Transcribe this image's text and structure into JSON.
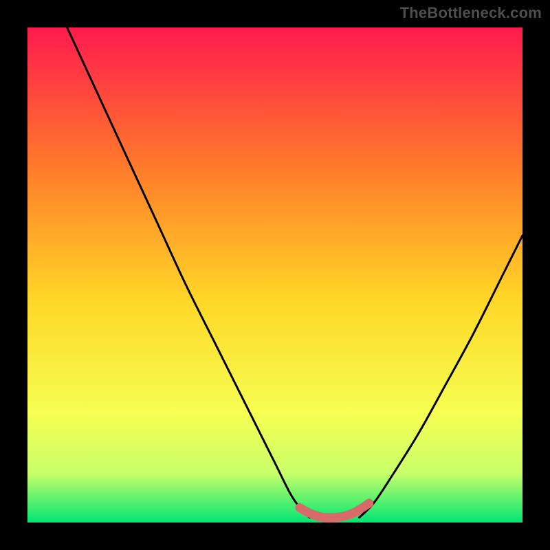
{
  "watermark": "TheBottleneck.com",
  "colors": {
    "frame": "#000000",
    "grad_top": "#ff1a4d",
    "grad_mid1": "#ff7a2a",
    "grad_mid2": "#ffd726",
    "grad_low1": "#f6ff52",
    "grad_low2": "#c8ff6a",
    "grad_bottom": "#00e673",
    "curve": "#000000",
    "dot": "#d96a6a"
  },
  "chart_data": {
    "type": "line",
    "title": "",
    "xlabel": "",
    "ylabel": "",
    "xlim": [
      0,
      100
    ],
    "ylim": [
      0,
      100
    ],
    "series": [
      {
        "name": "left-branch",
        "x": [
          8,
          14,
          20,
          26,
          32,
          38,
          44,
          50,
          53,
          55,
          57
        ],
        "y": [
          100,
          87,
          74,
          61,
          48,
          36,
          24,
          12,
          6,
          3,
          1
        ]
      },
      {
        "name": "right-branch",
        "x": [
          67,
          70,
          74,
          79,
          84,
          90,
          96,
          100
        ],
        "y": [
          1,
          4,
          10,
          18,
          27,
          38,
          50,
          58
        ]
      },
      {
        "name": "optimum-band",
        "x": [
          55,
          56,
          57,
          58,
          59,
          60,
          61,
          62,
          63,
          64,
          65,
          66,
          67,
          68,
          69
        ],
        "y": [
          3,
          2.4,
          1.9,
          1.5,
          1.2,
          1.0,
          1.0,
          1.0,
          1.1,
          1.3,
          1.6,
          2.0,
          2.6,
          3.2,
          3.9
        ]
      }
    ],
    "gradient_stops": [
      {
        "offset": 0.0,
        "color": "#ff1a4d"
      },
      {
        "offset": 0.28,
        "color": "#ff7a2a"
      },
      {
        "offset": 0.55,
        "color": "#ffd726"
      },
      {
        "offset": 0.78,
        "color": "#f6ff52"
      },
      {
        "offset": 0.9,
        "color": "#c8ff6a"
      },
      {
        "offset": 1.0,
        "color": "#00e673"
      }
    ]
  }
}
